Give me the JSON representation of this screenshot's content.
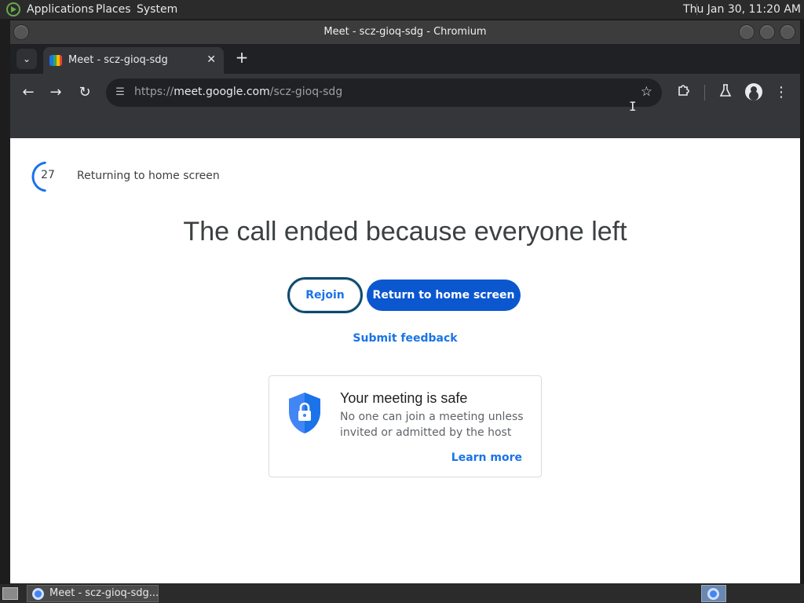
{
  "top_panel": {
    "menus": [
      "Applications",
      "Places",
      "System"
    ],
    "clock": "Thu Jan 30, 11:20 AM"
  },
  "window": {
    "title": "Meet - scz-gioq-sdg - Chromium"
  },
  "browser": {
    "tab_title": "Meet - scz-gioq-sdg",
    "tab_close": "✕",
    "new_tab": "+",
    "url_scheme": "https://",
    "url_host": "meet.google.com",
    "url_path": "/scz-gioq-sdg"
  },
  "page": {
    "countdown": "27",
    "countdown_fraction": 0.45,
    "returning_text": "Returning to home screen",
    "headline": "The call ended because everyone left",
    "rejoin_label": "Rejoin",
    "return_label": "Return to home screen",
    "feedback_label": "Submit feedback",
    "safe_card": {
      "title": "Your meeting is safe",
      "description": "No one can join a meeting unless invited or admitted by the host",
      "learn_more": "Learn more"
    }
  },
  "taskbar": {
    "task_label": "Meet - scz-gioq-sdg..."
  },
  "colors": {
    "accent_blue": "#1a73e8",
    "primary_button": "#0b57d0",
    "shield_blue": "#4285f4"
  },
  "icons": [
    "back-icon",
    "forward-icon",
    "reload-icon",
    "site-info-icon",
    "star-icon",
    "extensions-icon",
    "labs-icon",
    "profile-icon",
    "menu-icon",
    "shield-lock-icon"
  ]
}
